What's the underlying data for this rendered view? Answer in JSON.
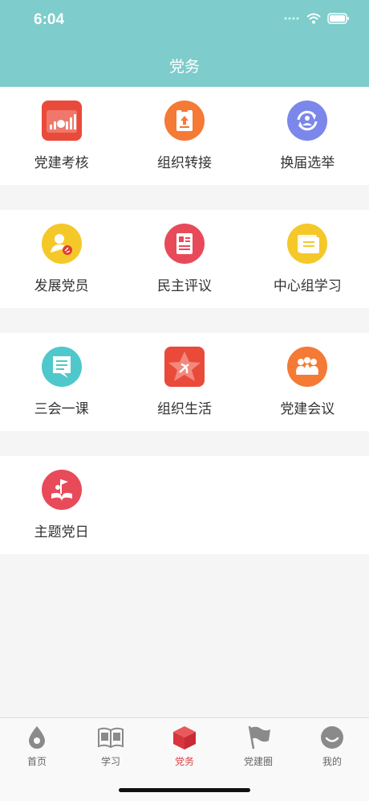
{
  "status": {
    "time": "6:04"
  },
  "header": {
    "title": "党务"
  },
  "sections": [
    {
      "items": [
        {
          "label": "党建考核",
          "icon": "chart-icon"
        },
        {
          "label": "组织转接",
          "icon": "transfer-icon"
        },
        {
          "label": "换届选举",
          "icon": "refresh-icon"
        }
      ]
    },
    {
      "items": [
        {
          "label": "发展党员",
          "icon": "member-icon"
        },
        {
          "label": "民主评议",
          "icon": "id-card-icon"
        },
        {
          "label": "中心组学习",
          "icon": "folder-icon"
        }
      ]
    },
    {
      "items": [
        {
          "label": "三会一课",
          "icon": "chat-doc-icon"
        },
        {
          "label": "组织生活",
          "icon": "star-party-icon"
        },
        {
          "label": "党建会议",
          "icon": "meeting-icon"
        }
      ]
    },
    {
      "items": [
        {
          "label": "主题党日",
          "icon": "book-flag-icon"
        }
      ]
    }
  ],
  "tabbar": [
    {
      "label": "首页",
      "icon": "drop-icon",
      "active": false
    },
    {
      "label": "学习",
      "icon": "book-icon",
      "active": false
    },
    {
      "label": "党务",
      "icon": "cube-icon",
      "active": true
    },
    {
      "label": "党建圈",
      "icon": "flag-icon",
      "active": false
    },
    {
      "label": "我的",
      "icon": "face-icon",
      "active": false
    }
  ],
  "colors": {
    "header": "#7ecccc",
    "accent": "#e03e3e"
  }
}
